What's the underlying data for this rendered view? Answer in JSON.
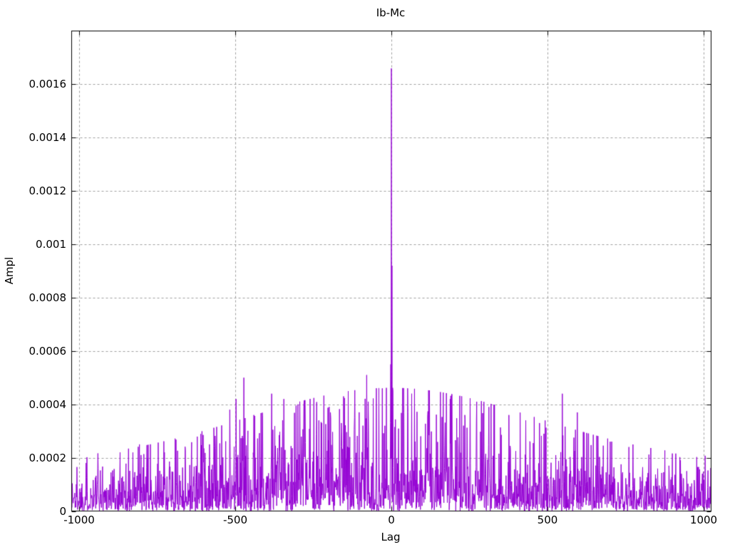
{
  "page": {
    "background": "#ffffff"
  },
  "chart_data": {
    "type": "line",
    "title": "Ib-Mc",
    "xlabel": "Lag",
    "ylabel": "Ampl",
    "xlim": [
      -1023,
      1023
    ],
    "ylim": [
      0,
      0.0018
    ],
    "x_ticks": [
      {
        "value": -1000,
        "label": "-1000"
      },
      {
        "value": -500,
        "label": "-500"
      },
      {
        "value": 0,
        "label": "0"
      },
      {
        "value": 500,
        "label": "500"
      },
      {
        "value": 1000,
        "label": "1000"
      }
    ],
    "y_ticks": [
      {
        "value": 0,
        "label": "0"
      },
      {
        "value": 0.0002,
        "label": "0.0002"
      },
      {
        "value": 0.0004,
        "label": "0.0004"
      },
      {
        "value": 0.0006,
        "label": "0.0006"
      },
      {
        "value": 0.0008,
        "label": "0.0008"
      },
      {
        "value": 0.001,
        "label": "0.001"
      },
      {
        "value": 0.0012,
        "label": "0.0012"
      },
      {
        "value": 0.0014,
        "label": "0.0014"
      },
      {
        "value": 0.0016,
        "label": "0.0016"
      }
    ],
    "grid": {
      "visible": true,
      "style": "dashed",
      "color": "#9e9e9e"
    },
    "legend": {
      "visible": false
    },
    "axis_color": "#000000",
    "text_color": "#000000",
    "tick_length": 6,
    "series": [
      {
        "name": "Ib-Mc",
        "color": "#9400d3",
        "style": "dense noisy line (impulse-like autocorrelation)",
        "lag_min": -1023,
        "lag_max": 1023,
        "lag_step": 1,
        "main_peak": {
          "lag": 0,
          "ampl": 0.00166
        },
        "secondary_peak": {
          "lag": 2,
          "ampl": 0.00092
        },
        "notable_spikes": [
          [
            -977,
            0.00018
          ],
          [
            -938,
            0.00016
          ],
          [
            -868,
            0.00022
          ],
          [
            -806,
            0.00025
          ],
          [
            -726,
            0.00022
          ],
          [
            -640,
            0.00021
          ],
          [
            -582,
            0.00025
          ],
          [
            -517,
            0.00038
          ],
          [
            -497,
            0.00042
          ],
          [
            -472,
            0.0005
          ],
          [
            -440,
            0.00036
          ],
          [
            -383,
            0.00044
          ],
          [
            -344,
            0.00042
          ],
          [
            -299,
            0.0004
          ],
          [
            -280,
            0.0004
          ],
          [
            -232,
            0.00034
          ],
          [
            -195,
            0.00037
          ],
          [
            -160,
            0.00033
          ],
          [
            -118,
            0.00035
          ],
          [
            -79,
            0.00051
          ],
          [
            -29,
            0.00046
          ],
          [
            -2,
            0.00055
          ],
          [
            5,
            0.00045
          ],
          [
            35,
            0.00038
          ],
          [
            65,
            0.00044
          ],
          [
            120,
            0.00036
          ],
          [
            188,
            0.00042
          ],
          [
            235,
            0.00036
          ],
          [
            273,
            0.00041
          ],
          [
            312,
            0.00039
          ],
          [
            376,
            0.00036
          ],
          [
            430,
            0.00034
          ],
          [
            474,
            0.00033
          ],
          [
            547,
            0.00044
          ],
          [
            595,
            0.00037
          ],
          [
            630,
            0.00029
          ],
          [
            700,
            0.00026
          ],
          [
            760,
            0.00024
          ],
          [
            830,
            0.0002
          ],
          [
            888,
            0.00017
          ],
          [
            925,
            0.00019
          ],
          [
            980,
            0.00016
          ]
        ],
        "noise_model": {
          "seed": 1337,
          "baseline": 5.5e-05,
          "center_boost": 8.5e-05,
          "envelope_half_width": 650,
          "distribution": "exponential",
          "cap_factor": 3.3
        }
      }
    ]
  }
}
